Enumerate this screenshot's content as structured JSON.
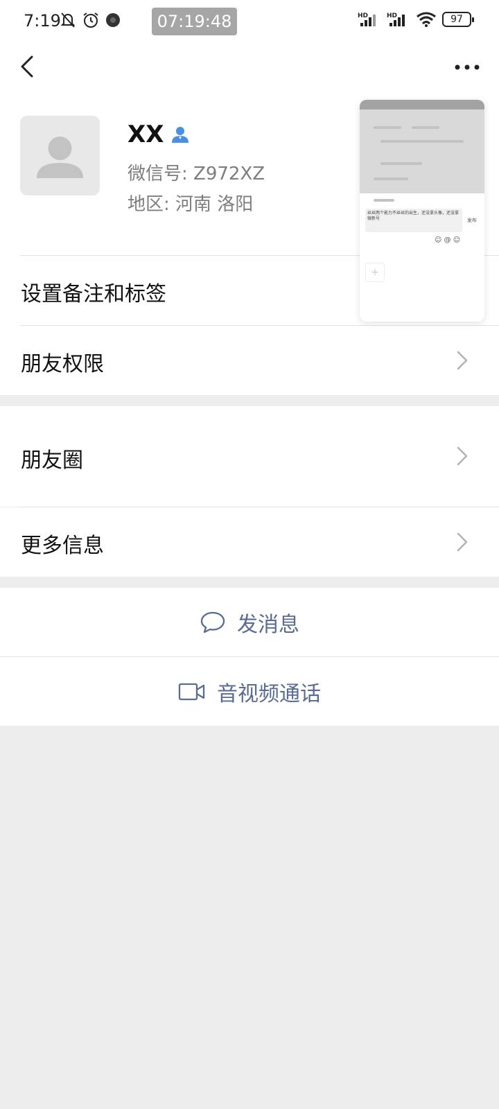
{
  "status_bar": {
    "time": "7:19",
    "recording_timer": "07:19:48",
    "battery": "97",
    "signal_label_1": "HD",
    "signal_label_2": "HD"
  },
  "navbar": {
    "back_icon": "chevron-left-icon",
    "more_icon": "more-dots-icon"
  },
  "profile": {
    "name": "XX",
    "wechat_id": "微信号: Z972XZ",
    "region": "地区: 河南  洛阳",
    "badge_icon": "person-badge-icon"
  },
  "menu": {
    "remark_tags": "设置备注和标签",
    "friend_permissions": "朋友权限",
    "moments": "朋友圈",
    "more_info": "更多信息"
  },
  "actions": {
    "send_message": "发消息",
    "av_call": "音视频通话"
  },
  "floating_preview": {
    "post_text": "丝丝两个能力不丝丝的出生，还没拿头像，还没拿 微新号",
    "publish_label": "发布"
  },
  "colors": {
    "link_blue": "#576b95",
    "badge_blue": "#4a90e2",
    "background": "#ededed"
  }
}
